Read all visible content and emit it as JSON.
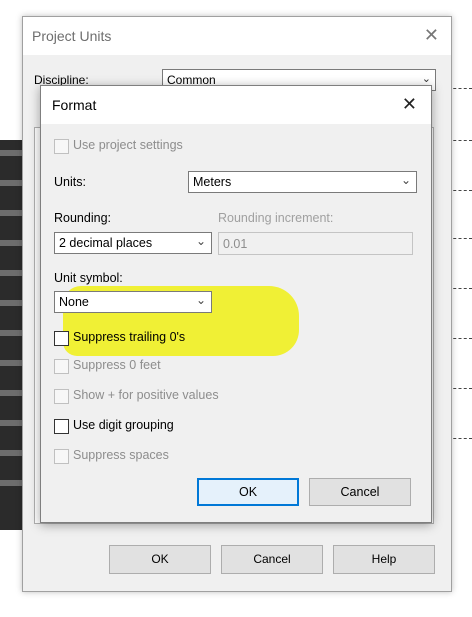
{
  "project_units": {
    "title": "Project Units",
    "discipline_label": "Discipline:",
    "discipline_value": "Common",
    "buttons": {
      "ok": "OK",
      "cancel": "Cancel",
      "help": "Help"
    }
  },
  "format": {
    "title": "Format",
    "use_project_settings": "Use project settings",
    "units_label": "Units:",
    "units_value": "Meters",
    "rounding_label": "Rounding:",
    "rounding_value": "2 decimal places",
    "rounding_increment_label": "Rounding increment:",
    "rounding_increment_value": "0.01",
    "unit_symbol_label": "Unit symbol:",
    "unit_symbol_value": "None",
    "suppress_trailing": "Suppress trailing 0's",
    "suppress_zero_feet": "Suppress 0 feet",
    "show_plus": "Show + for positive values",
    "use_digit_grouping": "Use digit grouping",
    "suppress_spaces": "Suppress spaces",
    "ok": "OK",
    "cancel": "Cancel"
  },
  "icons": {
    "close": "close-icon",
    "chevron": "chevron-down-icon"
  },
  "colors": {
    "highlight": "#f0f000",
    "default_button_border": "#0078d7"
  }
}
